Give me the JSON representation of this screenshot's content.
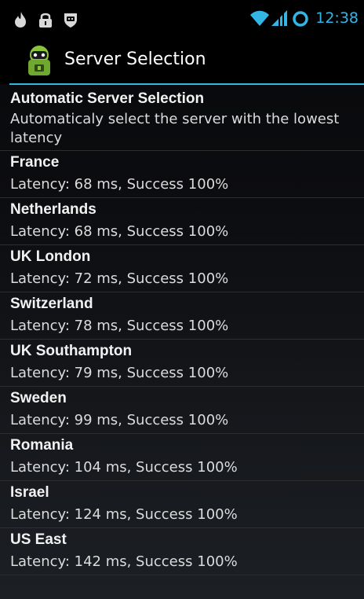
{
  "status_bar": {
    "time": "12:38",
    "accent_color": "#33b5e5",
    "icons": [
      "flame-icon",
      "lock-icon",
      "shield-icon",
      "wifi-icon",
      "signal-icon",
      "circle-icon"
    ]
  },
  "action_bar": {
    "title": "Server Selection",
    "app_icon": "android-vpn-icon",
    "accent_color": "#33b5e5"
  },
  "servers": [
    {
      "title": "Automatic Server Selection",
      "summary": "Automaticaly select the server with the lowest latency"
    },
    {
      "title": "France",
      "summary": "Latency: 68 ms, Success 100%"
    },
    {
      "title": "Netherlands",
      "summary": "Latency: 68 ms, Success 100%"
    },
    {
      "title": "UK London",
      "summary": "Latency: 72 ms, Success 100%"
    },
    {
      "title": "Switzerland",
      "summary": "Latency: 78 ms, Success 100%"
    },
    {
      "title": "UK Southampton",
      "summary": "Latency: 79 ms, Success 100%"
    },
    {
      "title": "Sweden",
      "summary": "Latency: 99 ms, Success 100%"
    },
    {
      "title": "Romania",
      "summary": "Latency: 104 ms, Success 100%"
    },
    {
      "title": "Israel",
      "summary": "Latency: 124 ms, Success 100%"
    },
    {
      "title": "US East",
      "summary": "Latency: 142 ms, Success 100%"
    }
  ]
}
